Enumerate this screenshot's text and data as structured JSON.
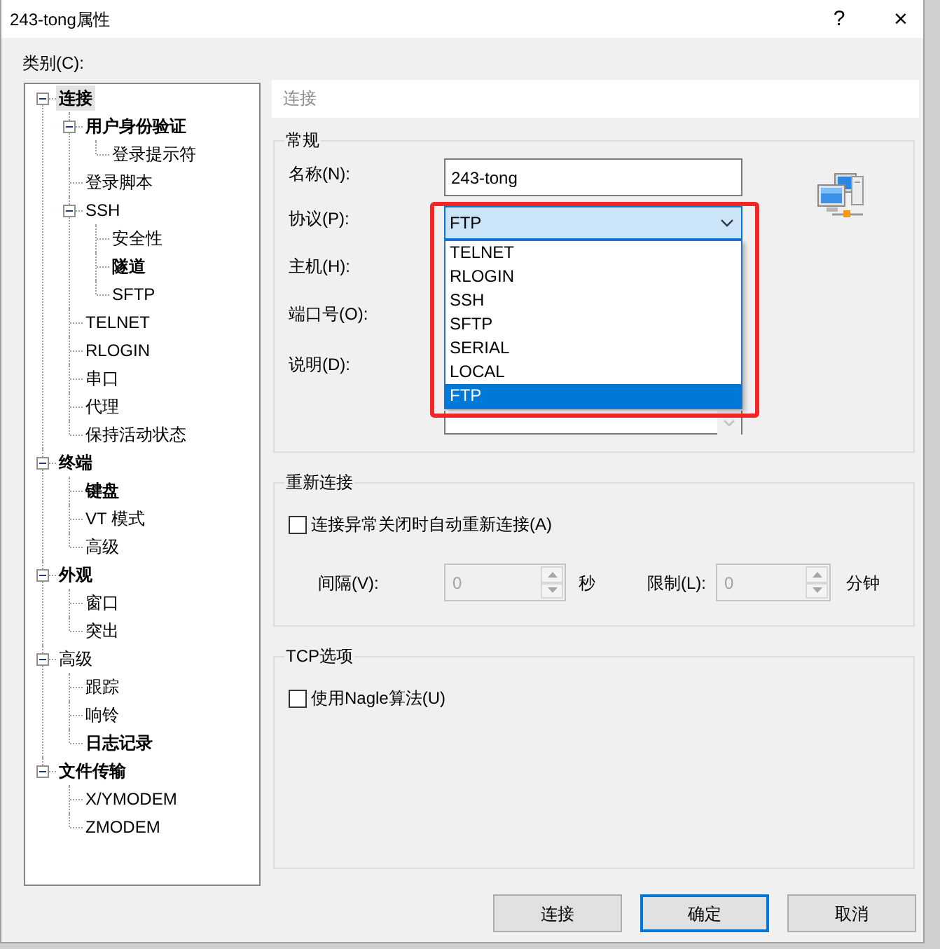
{
  "window": {
    "title": "243-tong属性",
    "title_buttons": [
      {
        "kind": "help",
        "label": "?"
      },
      {
        "kind": "close",
        "label": "×"
      }
    ]
  },
  "category_label": "类别(C):",
  "tree": [
    {
      "label": "连接",
      "bold": true,
      "selected": true,
      "expanded": true,
      "children": [
        {
          "label": "用户身份验证",
          "bold": true,
          "selected": false,
          "expanded": true,
          "children": [
            {
              "label": "登录提示符",
              "bold": false,
              "selected": false
            }
          ]
        },
        {
          "label": "登录脚本",
          "bold": false,
          "selected": false
        },
        {
          "label": "SSH",
          "bold": false,
          "selected": false,
          "expanded": true,
          "children": [
            {
              "label": "安全性",
              "bold": false,
              "selected": false
            },
            {
              "label": "隧道",
              "bold": true,
              "selected": false
            },
            {
              "label": "SFTP",
              "bold": false,
              "selected": false
            }
          ]
        },
        {
          "label": "TELNET",
          "bold": false,
          "selected": false
        },
        {
          "label": "RLOGIN",
          "bold": false,
          "selected": false
        },
        {
          "label": "串口",
          "bold": false,
          "selected": false
        },
        {
          "label": "代理",
          "bold": false,
          "selected": false
        },
        {
          "label": "保持活动状态",
          "bold": false,
          "selected": false
        }
      ]
    },
    {
      "label": "终端",
      "bold": true,
      "selected": false,
      "expanded": true,
      "children": [
        {
          "label": "键盘",
          "bold": true,
          "selected": false
        },
        {
          "label": "VT 模式",
          "bold": false,
          "selected": false
        },
        {
          "label": "高级",
          "bold": false,
          "selected": false
        }
      ]
    },
    {
      "label": "外观",
      "bold": true,
      "selected": false,
      "expanded": true,
      "children": [
        {
          "label": "窗口",
          "bold": false,
          "selected": false
        },
        {
          "label": "突出",
          "bold": false,
          "selected": false
        }
      ]
    },
    {
      "label": "高级",
      "bold": false,
      "selected": false,
      "expanded": true,
      "children": [
        {
          "label": "跟踪",
          "bold": false,
          "selected": false
        },
        {
          "label": "响铃",
          "bold": false,
          "selected": false
        },
        {
          "label": "日志记录",
          "bold": true,
          "selected": false
        }
      ]
    },
    {
      "label": "文件传输",
      "bold": true,
      "selected": false,
      "expanded": true,
      "children": [
        {
          "label": "X/YMODEM",
          "bold": false,
          "selected": false
        },
        {
          "label": "ZMODEM",
          "bold": false,
          "selected": false
        }
      ]
    }
  ],
  "panel_header": "连接",
  "general": {
    "legend": "常规",
    "name": {
      "label": "名称(N):",
      "value": "243-tong"
    },
    "protocol": {
      "label": "协议(P):",
      "value": "FTP",
      "expanded": true,
      "options": [
        {
          "label": "TELNET",
          "selected": false
        },
        {
          "label": "RLOGIN",
          "selected": false
        },
        {
          "label": "SSH",
          "selected": false
        },
        {
          "label": "SFTP",
          "selected": false
        },
        {
          "label": "SERIAL",
          "selected": false
        },
        {
          "label": "LOCAL",
          "selected": false
        },
        {
          "label": "FTP",
          "selected": true
        }
      ]
    },
    "host": {
      "label": "主机(H):"
    },
    "port": {
      "label": "端口号(O):"
    },
    "description": {
      "label": "说明(D):"
    }
  },
  "reconnect": {
    "legend": "重新连接",
    "auto_reconnect": {
      "label": "连接异常关闭时自动重新连接(A)",
      "checked": false
    },
    "interval": {
      "label": "间隔(V):",
      "value": "0",
      "unit": "秒",
      "disabled": true
    },
    "limit": {
      "label": "限制(L):",
      "value": "0",
      "unit": "分钟",
      "disabled": true
    }
  },
  "tcp": {
    "legend": "TCP选项",
    "nagle": {
      "label": "使用Nagle算法(U)",
      "checked": false
    }
  },
  "buttons": [
    {
      "label": "连接",
      "default": false
    },
    {
      "label": "确定",
      "default": true
    },
    {
      "label": "取消",
      "default": false
    }
  ]
}
